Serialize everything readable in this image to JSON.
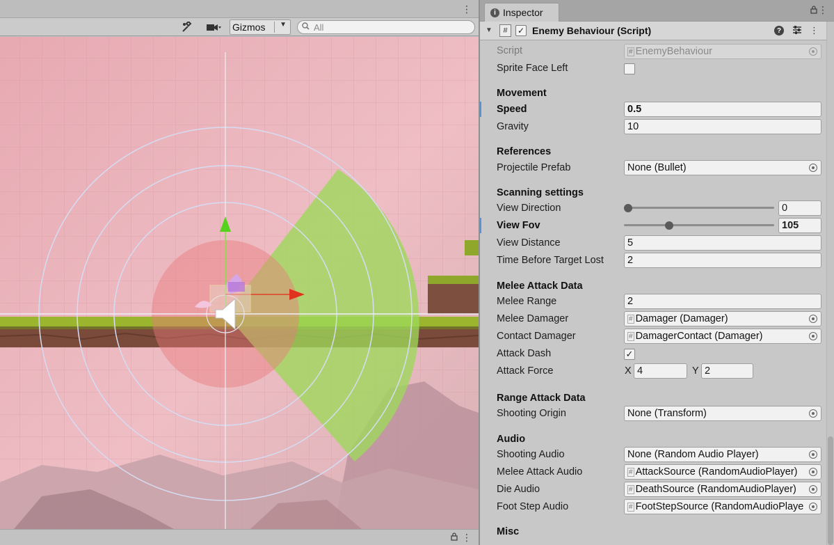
{
  "scene": {
    "toolbar": {
      "tool_icon": "tools-icon",
      "camera_icon": "camera-icon",
      "gizmos_label": "Gizmos",
      "search_placeholder": "All"
    }
  },
  "inspector": {
    "tab_label": "Inspector",
    "component": {
      "title": "Enemy Behaviour (Script)",
      "enabled": true
    },
    "script": {
      "label": "Script",
      "value": "EnemyBehaviour"
    },
    "sprite_face_left": {
      "label": "Sprite Face Left",
      "checked": false
    },
    "movement": {
      "header": "Movement",
      "speed": {
        "label": "Speed",
        "value": "0.5"
      },
      "gravity": {
        "label": "Gravity",
        "value": "10"
      }
    },
    "references": {
      "header": "References",
      "projectile_prefab": {
        "label": "Projectile Prefab",
        "value": "None (Bullet)"
      }
    },
    "scanning": {
      "header": "Scanning settings",
      "view_direction": {
        "label": "View Direction",
        "value": "0"
      },
      "view_fov": {
        "label": "View Fov",
        "value": "105"
      },
      "view_distance": {
        "label": "View Distance",
        "value": "5"
      },
      "time_before_target_lost": {
        "label": "Time Before Target Lost",
        "value": "2"
      }
    },
    "melee": {
      "header": "Melee Attack Data",
      "melee_range": {
        "label": "Melee Range",
        "value": "2"
      },
      "melee_damager": {
        "label": "Melee Damager",
        "value": "Damager (Damager)"
      },
      "contact_damager": {
        "label": "Contact Damager",
        "value": "DamagerContact (Damager)"
      },
      "attack_dash": {
        "label": "Attack Dash",
        "checked": true
      },
      "attack_force": {
        "label": "Attack Force",
        "x_label": "X",
        "x": "4",
        "y_label": "Y",
        "y": "2"
      }
    },
    "range": {
      "header": "Range Attack Data",
      "shooting_origin": {
        "label": "Shooting Origin",
        "value": "None (Transform)"
      }
    },
    "audio": {
      "header": "Audio",
      "shooting_audio": {
        "label": "Shooting Audio",
        "value": "None (Random Audio Player)"
      },
      "melee_attack_audio": {
        "label": "Melee Attack Audio",
        "value": "AttackSource (RandomAudioPlayer)"
      },
      "die_audio": {
        "label": "Die Audio",
        "value": "DeathSource (RandomAudioPlayer)"
      },
      "foot_step_audio": {
        "label": "Foot Step Audio",
        "value": "FootStepSource (RandomAudioPlayer)"
      }
    },
    "misc": {
      "header": "Misc"
    }
  }
}
